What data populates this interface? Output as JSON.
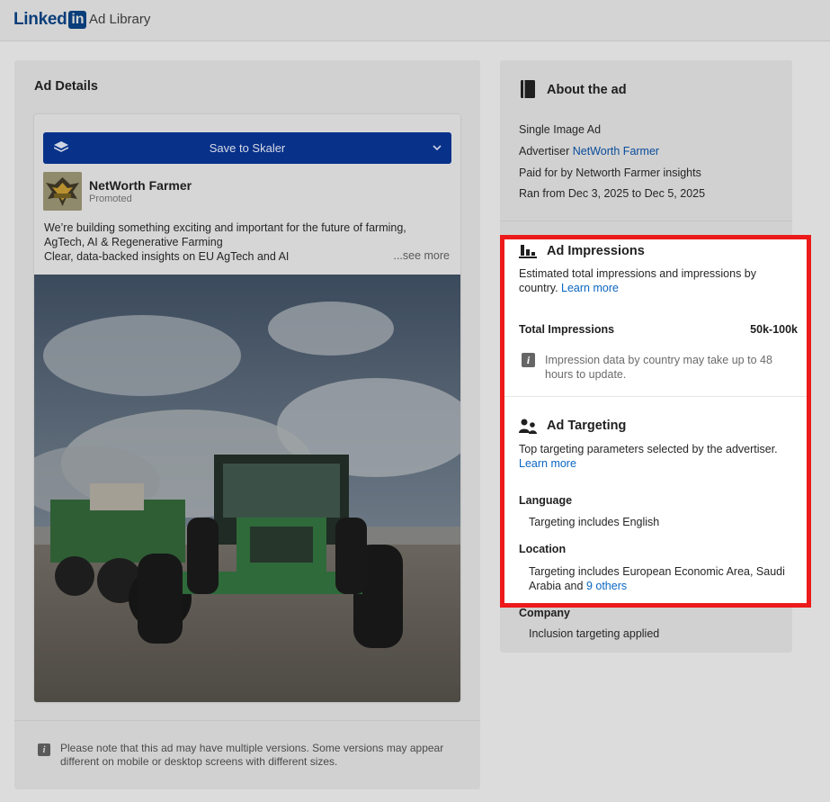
{
  "header": {
    "logo_text": "Linked",
    "logo_box": "in",
    "app_title": "Ad Library"
  },
  "ad_details": {
    "title": "Ad Details",
    "save_button": "Save to Skaler",
    "advertiser_name": "NetWorth Farmer",
    "promoted": "Promoted",
    "text_line1": "We’re building something exciting and important for the future of farming,",
    "text_line2": "AgTech, AI & Regenerative Farming",
    "text_line3": "Clear, data-backed insights on EU AgTech and AI",
    "see_more": "...see more",
    "note": "Please note that this ad may have multiple versions. Some versions may appear different on mobile or desktop screens with different sizes."
  },
  "about": {
    "title": "About the ad",
    "ad_type": "Single Image Ad",
    "advertiser_prefix": "Advertiser",
    "advertiser_link": "NetWorth Farmer",
    "paid_for": "Paid for by Networth Farmer insights",
    "ran_from": "Ran from Dec 3, 2025 to Dec 5, 2025"
  },
  "impressions": {
    "title": "Ad Impressions",
    "description": "Estimated total impressions and impressions by country.",
    "learn_more": "Learn more",
    "total_label": "Total Impressions",
    "total_value": "50k-100k",
    "info": "Impression data by country may take up to 48 hours to update."
  },
  "targeting": {
    "title": "Ad Targeting",
    "description": "Top targeting parameters selected by the advertiser.",
    "learn_more": "Learn more",
    "language_label": "Language",
    "language_value": "Targeting includes English",
    "location_label": "Location",
    "location_value": "Targeting includes European Economic Area, Saudi Arabia and",
    "location_link": "9 others",
    "company_label": "Company",
    "company_value": "Inclusion targeting applied"
  },
  "colors": {
    "brand": "#0a3e7a",
    "skaler_button": "#08318a",
    "link": "#0a66c2",
    "highlight_border": "#ec1a1a"
  }
}
